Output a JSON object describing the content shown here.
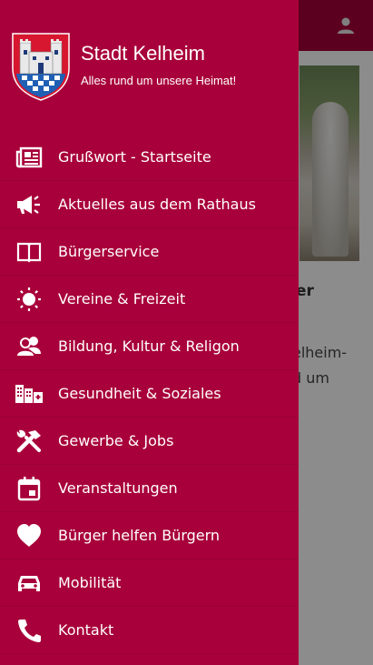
{
  "drawer": {
    "title": "Stadt Kelheim",
    "subtitle": "Alles rund um unsere Heimat!",
    "items": [
      {
        "label": "Grußwort - Startseite",
        "icon": "newspaper-icon"
      },
      {
        "label": "Aktuelles aus dem Rathaus",
        "icon": "megaphone-icon"
      },
      {
        "label": "Bürgerservice",
        "icon": "book-icon"
      },
      {
        "label": "Vereine & Freizeit",
        "icon": "sun-icon"
      },
      {
        "label": "Bildung, Kultur & Religon",
        "icon": "people-icon"
      },
      {
        "label": "Gesundheit & Soziales",
        "icon": "buildings-icon"
      },
      {
        "label": "Gewerbe & Jobs",
        "icon": "tools-icon"
      },
      {
        "label": "Veranstaltungen",
        "icon": "calendar-icon"
      },
      {
        "label": "Bürger helfen Bürgern",
        "icon": "heart-icon"
      },
      {
        "label": "Mobilität",
        "icon": "car-icon"
      },
      {
        "label": "Kontakt",
        "icon": "phone-icon"
      }
    ]
  },
  "background": {
    "heading_fragment": "er",
    "text_fragment_1": "elheim-",
    "text_fragment_2": "d um"
  },
  "colors": {
    "brand": "#a8003a",
    "drawer_text": "#ffffff"
  }
}
